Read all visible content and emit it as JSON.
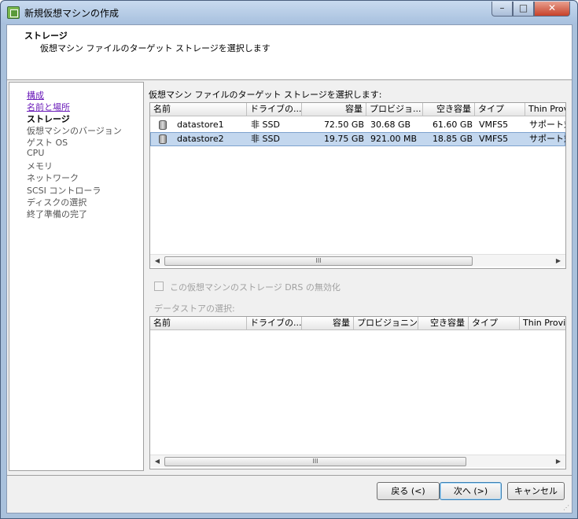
{
  "window": {
    "title": "新規仮想マシンの作成"
  },
  "header": {
    "title": "ストレージ",
    "subtitle": "仮想マシン ファイルのターゲット ストレージを選択します"
  },
  "nav": {
    "items": [
      {
        "label": "構成",
        "state": "link"
      },
      {
        "label": "名前と場所",
        "state": "link"
      },
      {
        "label": "ストレージ",
        "state": "current"
      },
      {
        "label": "仮想マシンのバージョン",
        "state": "disabled"
      },
      {
        "label": "ゲスト OS",
        "state": "disabled"
      },
      {
        "label": "CPU",
        "state": "disabled"
      },
      {
        "label": "メモリ",
        "state": "disabled"
      },
      {
        "label": "ネットワーク",
        "state": "disabled"
      },
      {
        "label": "SCSI コントローラ",
        "state": "disabled"
      },
      {
        "label": "ディスクの選択",
        "state": "disabled"
      },
      {
        "label": "終了準備の完了",
        "state": "disabled"
      }
    ]
  },
  "main": {
    "label": "仮想マシン ファイルのターゲット ストレージを選択します:",
    "datastore_table": {
      "columns": [
        "名前",
        "ドライブの...",
        "容量",
        "プロビジョ...",
        "空き容量",
        "タイプ",
        "Thin Prov"
      ],
      "rows": [
        {
          "name": "datastore1",
          "drive": "非 SSD",
          "capacity": "72.50 GB",
          "provisioned": "30.68 GB",
          "free": "61.60 GB",
          "type": "VMFS5",
          "thin": "サポート対"
        },
        {
          "name": "datastore2",
          "drive": "非 SSD",
          "capacity": "19.75 GB",
          "provisioned": "921.00 MB",
          "free": "18.85 GB",
          "type": "VMFS5",
          "thin": "サポート対",
          "selected": true
        }
      ]
    },
    "sdrs_checkbox": {
      "label": "この仮想マシンのストレージ DRS の無効化",
      "checked": false,
      "enabled": false
    },
    "datastore_select_label": "データストアの選択:",
    "selection_table": {
      "columns": [
        "名前",
        "ドライブの...",
        "容量",
        "プロビジョニン...",
        "空き容量",
        "タイプ",
        "Thin Provi"
      ]
    },
    "scroll_thumb_glyph": "III"
  },
  "footer": {
    "back_label": "戻る (<)",
    "next_label": "次へ (>)",
    "cancel_label": "キャンセル"
  }
}
